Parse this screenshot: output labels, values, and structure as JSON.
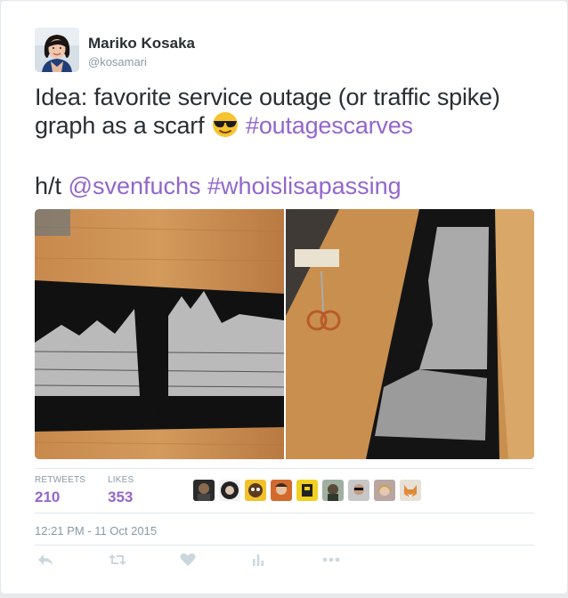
{
  "author": {
    "name": "Mariko Kosaka",
    "handle": "@kosamari"
  },
  "tweet": {
    "line1": "Idea: favorite service outage (or traffic spike)",
    "line2_text": "graph as a scarf ",
    "line2_hashtag": "#outagescarves",
    "line3_prefix": "h/t ",
    "mention": "@svenfuchs",
    "hashtag2": "#whoislisapassing"
  },
  "stats": {
    "retweets_label": "RETWEETS",
    "retweets_value": "210",
    "likes_label": "LIKES",
    "likes_value": "353"
  },
  "timestamp": "12:21 PM - 11 Oct 2015",
  "colors": {
    "link": "#9266cc",
    "text": "#292f33",
    "muted": "#8899a6",
    "action_icon": "#ccd6dd"
  },
  "icons": [
    "reply-icon",
    "retweet-icon",
    "like-icon",
    "analytics-icon",
    "more-icon"
  ]
}
